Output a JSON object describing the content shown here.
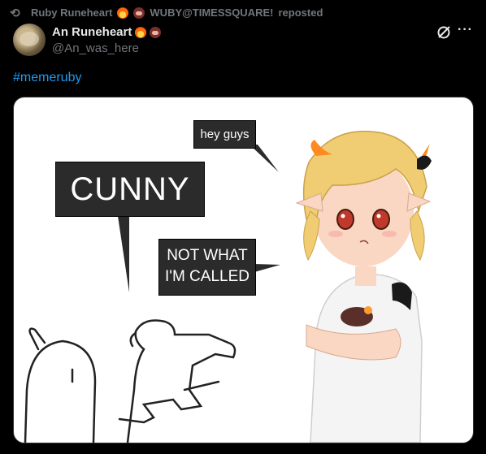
{
  "repost": {
    "icon": "repost-icon",
    "user": "Ruby Runeheart",
    "user_emojis": [
      "fire-emoji",
      "boar-emoji"
    ],
    "handle_text": "WUBY@TIMESSQUARE!",
    "suffix": "reposted"
  },
  "author": {
    "display_name": "An Runeheart",
    "emojis": [
      "fire-emoji",
      "boar-emoji"
    ],
    "handle": "@An_was_here"
  },
  "actions": {
    "grok_icon": "grok-icon",
    "more_icon": "more-icon",
    "more_label": "···"
  },
  "post": {
    "hashtag": "#memeruby"
  },
  "media": {
    "bubble_hey": "hey guys",
    "bubble_cunny": "CUNNY",
    "bubble_not_line1": "NOT WHAT",
    "bubble_not_line2": "I'M CALLED"
  },
  "colors": {
    "background": "#000000",
    "link": "#1d9bf0",
    "muted": "#71767b",
    "text": "#e7e9ea"
  }
}
